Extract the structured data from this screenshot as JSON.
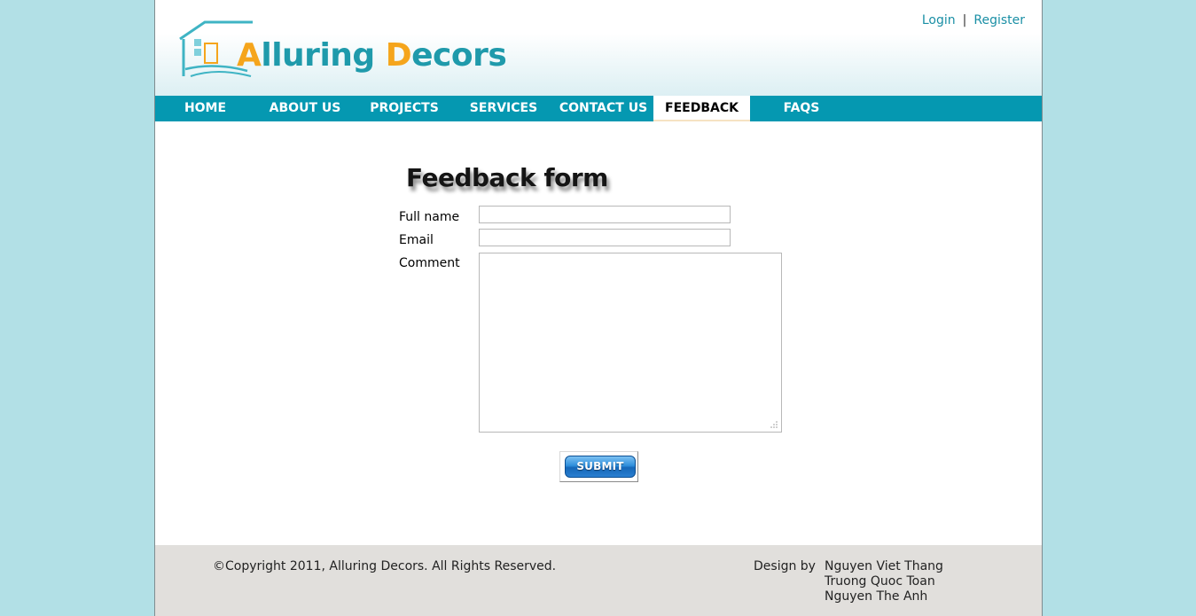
{
  "brand": {
    "part1_initial": "A",
    "part1_rest": "lluring ",
    "part2_initial": "D",
    "part2_rest": "ecors"
  },
  "auth": {
    "login": "Login",
    "separator": "|",
    "register": "Register"
  },
  "nav": {
    "items": [
      {
        "label": "HOME"
      },
      {
        "label": "ABOUT US"
      },
      {
        "label": "PROJECTS"
      },
      {
        "label": "SERVICES"
      },
      {
        "label": "CONTACT US"
      },
      {
        "label": "FEEDBACK",
        "active": true
      },
      {
        "label": "FAQS"
      }
    ]
  },
  "form": {
    "title": "Feedback form",
    "full_name_label": "Full name",
    "full_name_value": "",
    "email_label": "Email",
    "email_value": "",
    "comment_label": "Comment",
    "comment_value": "",
    "submit_label": "SUBMIT"
  },
  "footer": {
    "copyright": "©Copyright 2011, Alluring Decors. All Rights Reserved.",
    "design_by_label": "Design by",
    "designers": [
      "Nguyen Viet Thang",
      "Truong Quoc Toan",
      "Nguyen The Anh"
    ]
  },
  "colors": {
    "background": "#b2e0e6",
    "nav": "#0598b1",
    "brand_teal": "#1f9aab",
    "brand_orange": "#f5a51c",
    "footer": "#e1dfdc"
  }
}
